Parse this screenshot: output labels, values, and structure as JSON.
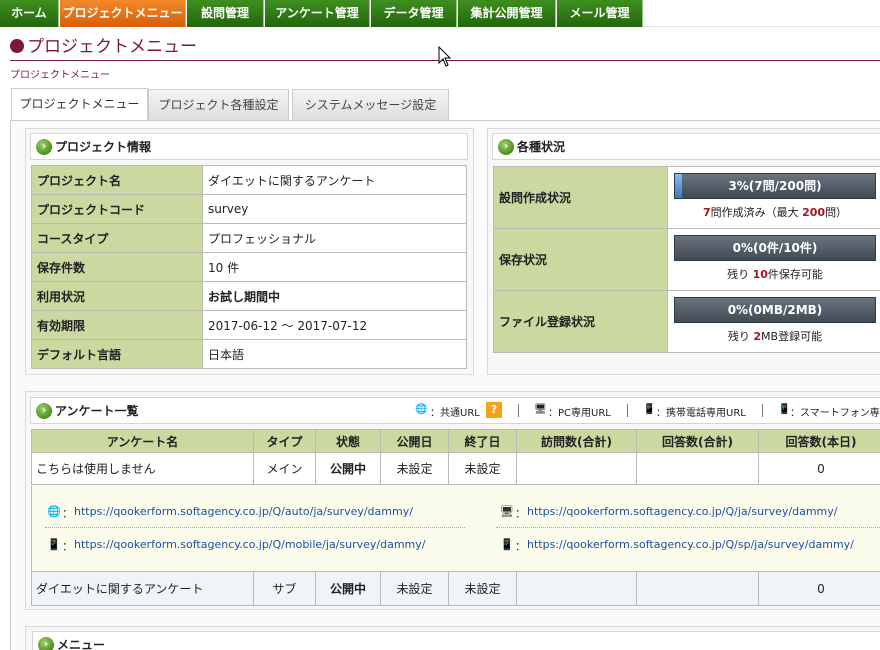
{
  "nav": [
    "ホーム",
    "プロジェクトメニュー",
    "設問管理",
    "アンケート管理",
    "データ管理",
    "集計公開管理",
    "メール管理"
  ],
  "page": {
    "title": "プロジェクトメニュー",
    "breadcrumb": "プロジェクトメニュー"
  },
  "tabs": [
    "プロジェクトメニュー",
    "プロジェクト各種設定",
    "システムメッセージ設定"
  ],
  "project_info": {
    "heading": "プロジェクト情報",
    "rows": [
      {
        "label": "プロジェクト名",
        "value": "ダイエットに関するアンケート"
      },
      {
        "label": "プロジェクトコード",
        "value": "survey"
      },
      {
        "label": "コースタイプ",
        "value": "プロフェッショナル"
      },
      {
        "label": "保存件数",
        "value": "10 件"
      },
      {
        "label": "利用状況",
        "value": "お試し期間中"
      },
      {
        "label": "有効期限",
        "value": "2017-06-12 ～ 2017-07-12"
      },
      {
        "label": "デフォルト言語",
        "value": "日本語"
      }
    ]
  },
  "status": {
    "heading": "各種状況",
    "rows": [
      {
        "label": "設問作成状況",
        "bar": "3%(7問/200問)",
        "fraction": 0.035,
        "pre": "",
        "num": "7",
        "post": "問作成済み（最大 ",
        "num2": "200",
        "post2": "問）"
      },
      {
        "label": "保存状況",
        "bar": "0%(0件/10件)",
        "fraction": 0,
        "pre": "残り ",
        "num": "10",
        "post": "件保存可能",
        "num2": "",
        "post2": ""
      },
      {
        "label": "ファイル登録状況",
        "bar": "0%(0MB/2MB)",
        "fraction": 0,
        "pre": "残り ",
        "num": "2",
        "post": "MB登録可能",
        "num2": "",
        "post2": ""
      }
    ]
  },
  "survey_list": {
    "heading": "アンケート一覧",
    "legend": {
      "common": "：共通URL",
      "help": "?",
      "pc": "：PC専用URL",
      "mobile": "：携帯電話専用URL",
      "smart": "：スマートフォン専用"
    },
    "columns": [
      "アンケート名",
      "タイプ",
      "状態",
      "公開日",
      "終了日",
      "訪問数(合計)",
      "回答数(合計)",
      "回答数(本日)"
    ],
    "rows": [
      {
        "name": "こちらは使用しません",
        "type": "メイン",
        "state": "公開中",
        "open": "未設定",
        "end": "未設定",
        "visits": "",
        "answers": "",
        "today": "0"
      },
      {
        "name": "ダイエットに関するアンケート",
        "type": "サブ",
        "state": "公開中",
        "open": "未設定",
        "end": "未設定",
        "visits": "",
        "answers": "",
        "today": "0"
      }
    ],
    "urls": {
      "common": "https://qookerform.softagency.co.jp/Q/auto/ja/survey/dammy/",
      "pc": "https://qookerform.softagency.co.jp/Q/ja/survey/dammy/",
      "mobile": "https://qookerform.softagency.co.jp/Q/mobile/ja/survey/dammy/",
      "smart": "https://qookerform.softagency.co.jp/Q/sp/ja/survey/dammy/",
      "sep": "："
    }
  },
  "menu": {
    "heading": "メニュー"
  },
  "icons": {
    "arrow": "›",
    "globe": "🌐",
    "pc": "🖥",
    "mobile": "📱",
    "smart": "📱"
  }
}
